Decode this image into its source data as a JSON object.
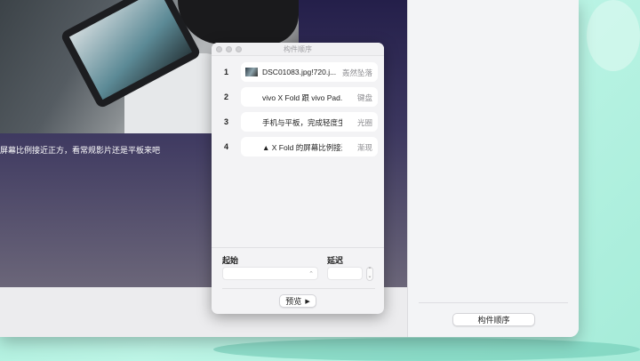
{
  "canvas": {
    "caption": "屏幕比例接近正方，看常规影片还是平板来吧"
  },
  "sidebar": {
    "button_label": "构件顺序"
  },
  "panel": {
    "title": "构件顺序",
    "items": [
      {
        "index": "1",
        "label": "DSC01083.jpg!720.j...",
        "effect": "轰然坠落",
        "has_thumbnail": true
      },
      {
        "index": "2",
        "label": "vivo X Fold 跟 vivo Pad...",
        "effect": "键盘"
      },
      {
        "index": "3",
        "label": "手机与平板，完成轻度生...",
        "effect": "光圈"
      },
      {
        "index": "4",
        "label": "▲ X Fold 的屏幕比例接近...",
        "effect": "渐现"
      }
    ],
    "start_label": "起始",
    "start_value": "",
    "delay_label": "延迟",
    "delay_value": "",
    "preview_label": "预览",
    "preview_icon": "▶"
  }
}
